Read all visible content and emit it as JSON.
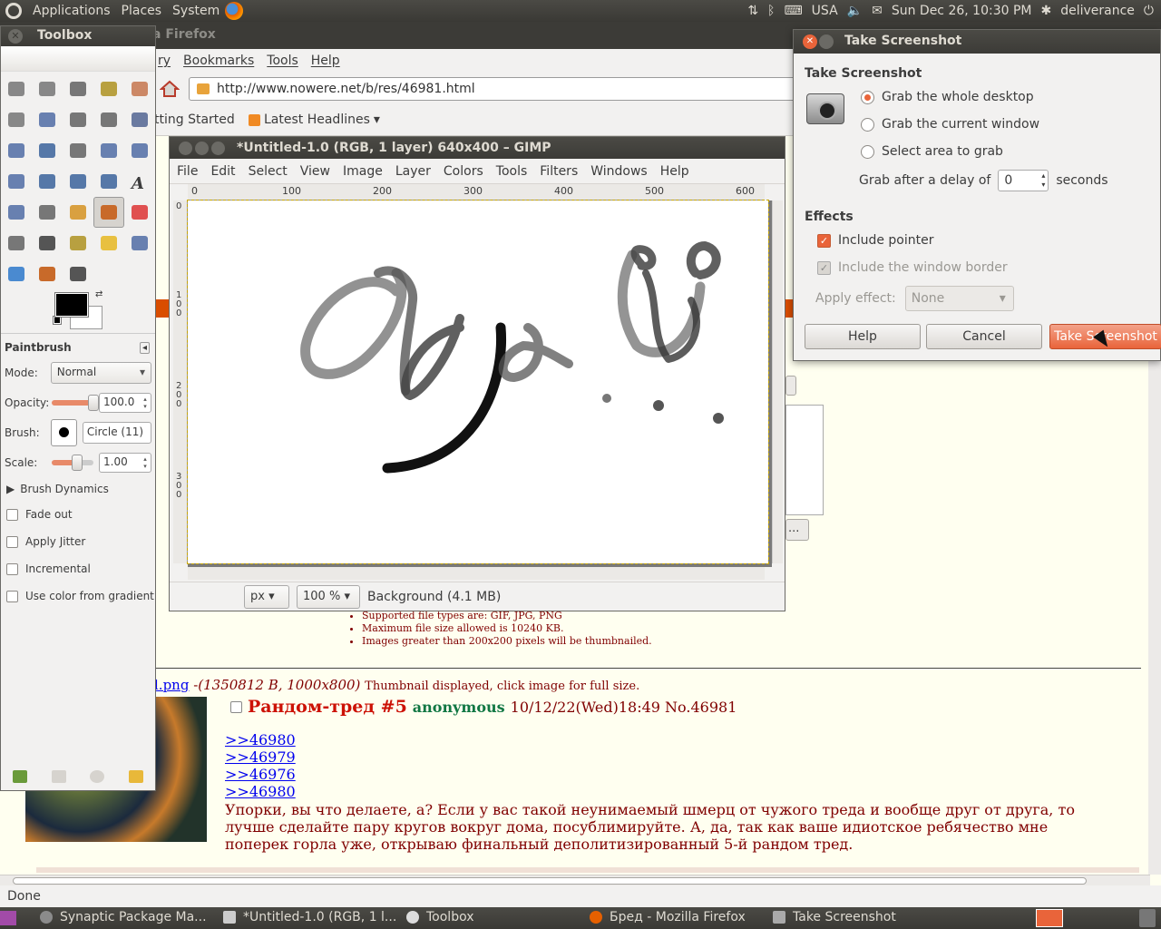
{
  "top_panel": {
    "menus": [
      "Applications",
      "Places",
      "System"
    ],
    "keyboard_layout": "USA",
    "datetime": "Sun Dec 26, 10:30 PM",
    "user": "deliverance"
  },
  "firefox": {
    "title_fragment": "a Firefox",
    "menu": [
      "ry",
      "Bookmarks",
      "Tools",
      "Help"
    ],
    "url": "http://www.nowere.net/b/res/46981.html",
    "bookmarks": [
      "tting Started",
      "Latest Headlines"
    ],
    "status": "Done",
    "rules": [
      "Supported file types are: GIF, JPG, PNG",
      "Maximum file size allowed is 10240 KB.",
      "Images greater than 200x200 pixels will be thumbnailed."
    ],
    "file_link": "l.png",
    "file_meta": "(1350812 B, 1000x800)",
    "file_note": "Thumbnail displayed, click image for full size.",
    "post": {
      "title": "Рандом-тред #5",
      "name": "anonymous",
      "date": "10/12/22(Wed)18:49 No.46981",
      "replies": [
        ">>46980",
        ">>46979",
        ">>46976",
        ">>46980"
      ],
      "body": "Упорки, вы что делаете, а? Если у вас такой неунимаемый шмерц от чужого треда и вообще друг от друга, то лучше сделайте пару кругов вокруг дома, посублимируйте. А, да, так как ваше идиотское ребячество мне поперек горла уже, открываю финальный деполитизированный 5-й рандом тред."
    },
    "behind_button": "..."
  },
  "toolbox": {
    "title": "Toolbox",
    "tools": [
      "rect-select-icon",
      "ellipse-select-icon",
      "lasso-icon",
      "fuzzy-select-icon",
      "color-select-icon",
      "scissors-icon",
      "foreground-select-icon",
      "paths-icon",
      "color-picker-icon",
      "zoom-icon",
      "measure-icon",
      "move-icon",
      "align-icon",
      "crop-icon",
      "rotate-icon",
      "scale-icon",
      "shear-icon",
      "perspective-icon",
      "flip-icon",
      "text-icon",
      "bucket-fill-icon",
      "blend-icon",
      "pencil-icon",
      "paintbrush-icon",
      "eraser-icon",
      "airbrush-icon",
      "ink-icon",
      "clone-icon",
      "heal-icon",
      "perspective-clone-icon",
      "blur-icon",
      "smudge-icon",
      "dodge-burn-icon"
    ],
    "options": {
      "title": "Paintbrush",
      "mode_label": "Mode:",
      "mode_value": "Normal",
      "opacity_label": "Opacity:",
      "opacity_value": "100.0",
      "brush_label": "Brush:",
      "brush_value": "Circle (11)",
      "scale_label": "Scale:",
      "scale_value": "1.00",
      "brush_dynamics": "Brush Dynamics",
      "checks": [
        "Fade out",
        "Apply Jitter",
        "Incremental",
        "Use color from gradient"
      ]
    },
    "opacity_fraction": 1.0,
    "scale_fraction": 0.6
  },
  "gimp": {
    "title": "*Untitled-1.0 (RGB, 1 layer) 640x400 – GIMP",
    "menu": [
      "File",
      "Edit",
      "Select",
      "View",
      "Image",
      "Layer",
      "Colors",
      "Tools",
      "Filters",
      "Windows",
      "Help"
    ],
    "hruler": [
      "0",
      "100",
      "200",
      "300",
      "400",
      "500",
      "600"
    ],
    "vruler": [
      "0",
      "100",
      "200",
      "300"
    ],
    "unit": "px",
    "zoom": "100 %",
    "status": "Background (4.1 MB)"
  },
  "dialog": {
    "title": "Take Screenshot",
    "section1": "Take Screenshot",
    "radios": [
      "Grab the whole desktop",
      "Grab the current window",
      "Select area to grab"
    ],
    "selected_radio": 0,
    "delay_label": "Grab after a delay of",
    "delay_value": "0",
    "delay_unit": "seconds",
    "section2": "Effects",
    "include_pointer": "Include pointer",
    "include_border": "Include the window border",
    "apply_effect_label": "Apply effect:",
    "apply_effect_value": "None",
    "buttons": [
      "Help",
      "Cancel",
      "Take Screenshot"
    ]
  },
  "taskbar": [
    "Synaptic Package Ma...",
    "*Untitled-1.0 (RGB, 1 l...",
    "Toolbox",
    "Бред - Mozilla Firefox",
    "Take Screenshot"
  ]
}
